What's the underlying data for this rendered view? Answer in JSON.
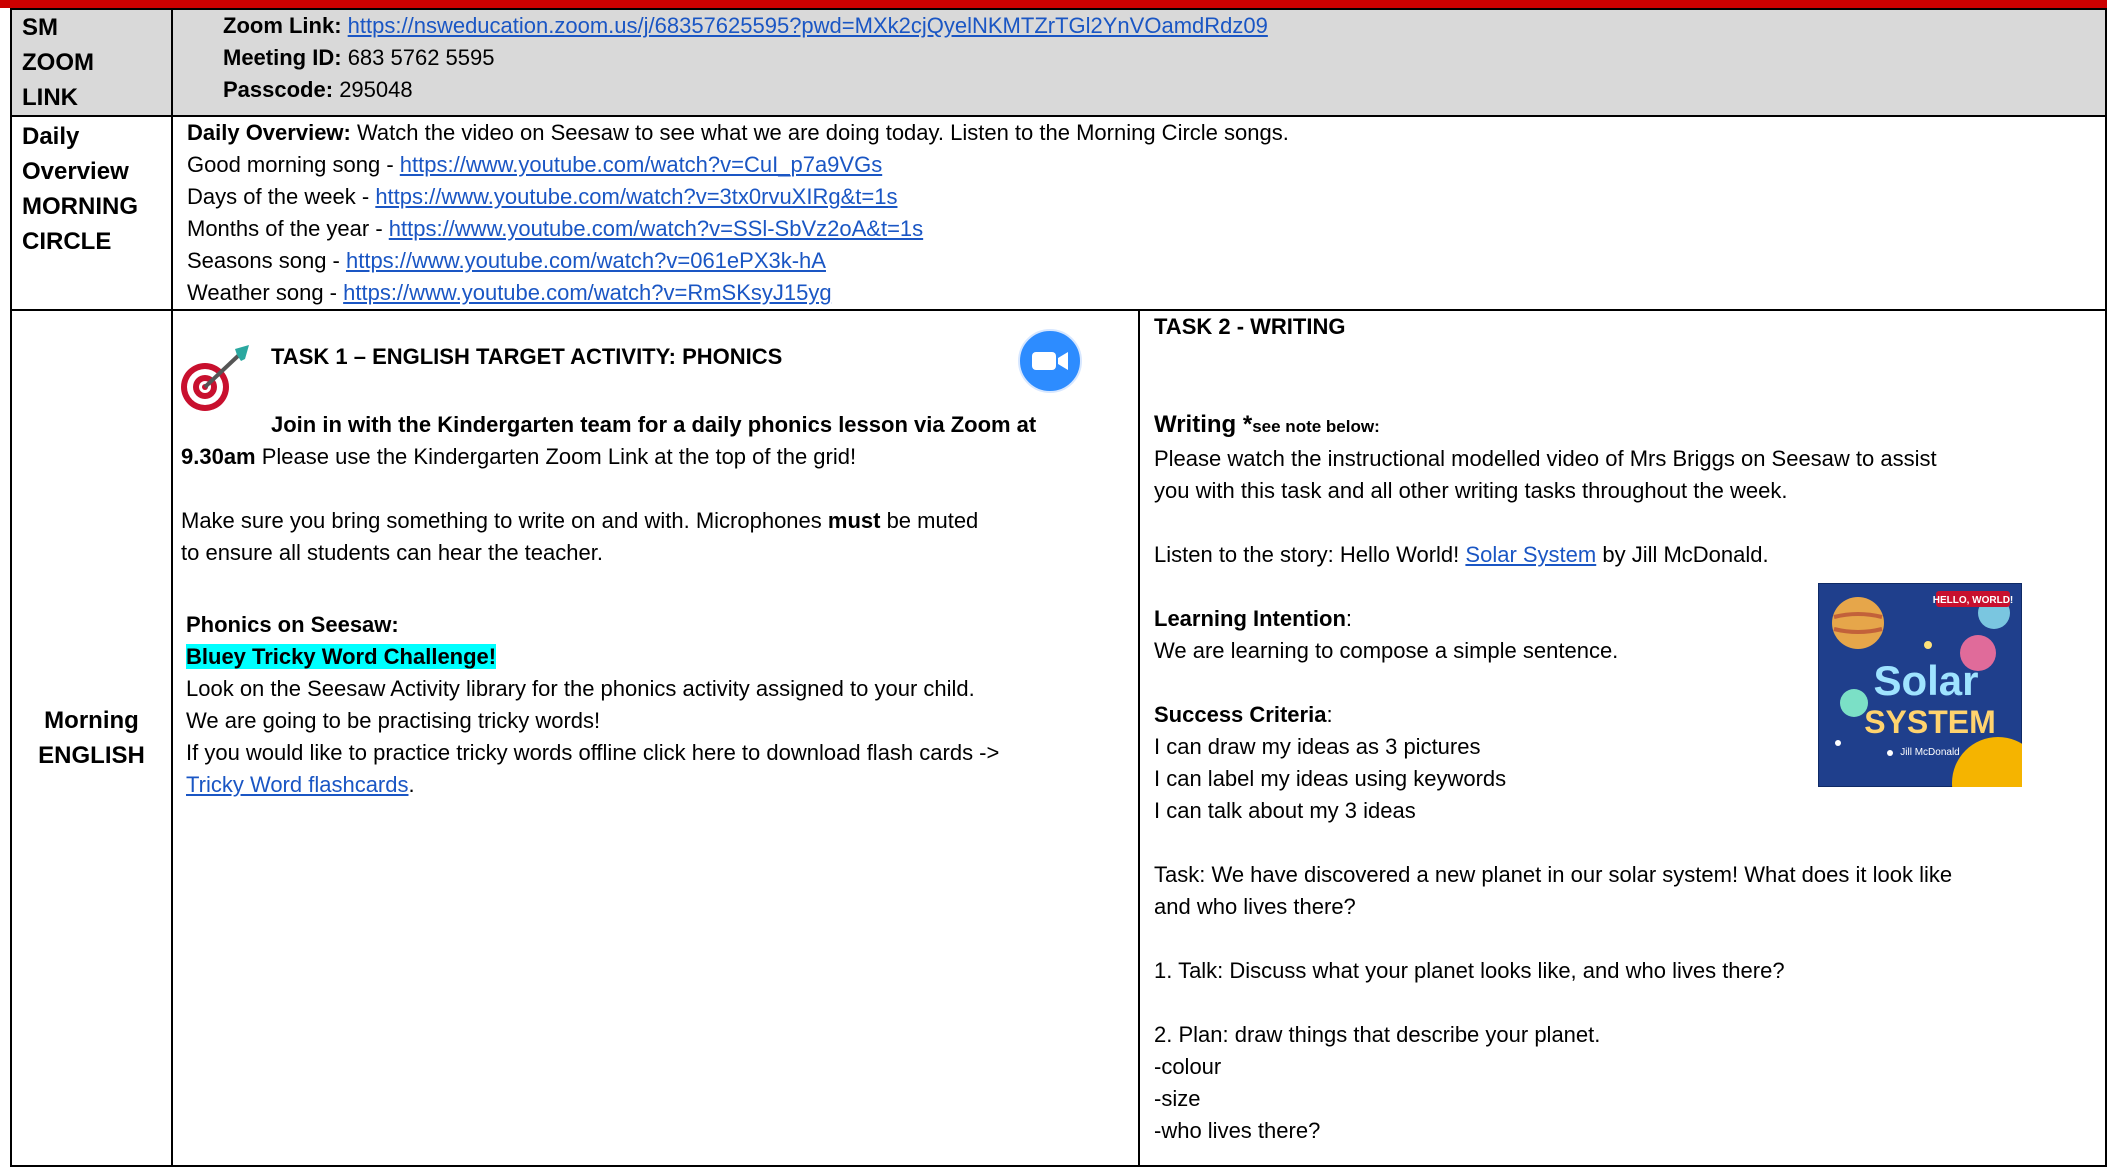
{
  "zoom_row": {
    "label": [
      "SM",
      "ZOOM",
      "LINK"
    ],
    "zoom_link_label": "Zoom Link:",
    "zoom_link_url": "https://nsweducation.zoom.us/j/68357625595?pwd=MXk2cjQyelNKMTZrTGl2YnVOamdRdz09",
    "meeting_id_label": "Meeting ID:",
    "meeting_id": "683 5762 5595",
    "passcode_label": "Passcode:",
    "passcode": "295048"
  },
  "overview_row": {
    "label": [
      "Daily",
      "Overview",
      "MORNING",
      "CIRCLE"
    ],
    "intro_label": "Daily Overview:",
    "intro_text": " Watch the video on Seesaw to see what we are doing today. Listen to the Morning Circle songs.",
    "songs": [
      {
        "name": "Good morning song - ",
        "url": "https://www.youtube.com/watch?v=CuI_p7a9VGs"
      },
      {
        "name": "Days of the week - ",
        "url": "https://www.youtube.com/watch?v=3tx0rvuXIRg&t=1s"
      },
      {
        "name": "Months of the year - ",
        "url": "https://www.youtube.com/watch?v=SSl-SbVz2oA&t=1s"
      },
      {
        "name": "Seasons song - ",
        "url": "https://www.youtube.com/watch?v=061ePX3k-hA"
      },
      {
        "name": "Weather song - ",
        "url": "https://www.youtube.com/watch?v=RmSKsyJ15yg"
      }
    ]
  },
  "english_row": {
    "label": [
      "Morning",
      "ENGLISH"
    ],
    "task1": {
      "heading": "TASK 1 – ENGLISH TARGET ACTIVITY: PHONICS",
      "join_bold": "Join in with the Kindergarten team for a daily phonics lesson via Zoom at",
      "time_bold": "9.30am",
      "join_rest": " Please use the Kindergarten Zoom Link at the top of the grid!",
      "bring_a": "Make sure you bring something to write on and with. Microphones ",
      "bring_must": "must",
      "bring_b": " be muted",
      "bring_c": "to ensure all students can hear the teacher.",
      "phonics_heading": "Phonics on Seesaw:",
      "challenge": "Bluey Tricky Word Challenge!",
      "look": "Look on the Seesaw Activity library for the phonics activity assigned to your child.",
      "practising": "We are going to be practising tricky words!",
      "offline": "If you would like to practice tricky words offline click here to download flash cards ->",
      "flashcards_link": "Tricky Word flashcards",
      "flashcards_after": "."
    },
    "task2": {
      "heading": "TASK 2 - WRITING",
      "writing_label": "Writing *",
      "writing_note": "see note below:",
      "watch_a": "Please watch the instructional modelled video of Mrs Briggs on Seesaw to assist",
      "watch_b": "you with this task and all other writing tasks throughout the week.",
      "story_a": "Listen to the story: Hello World! ",
      "story_link": "Solar System",
      "story_b": " by Jill McDonald.",
      "li_label": "Learning Intention",
      "li_colon": ":",
      "li_text": "We are learning to compose a simple sentence.",
      "sc_label": "Success Criteria",
      "sc_colon": ":",
      "sc_items": [
        "I can draw my ideas as 3 pictures",
        "I can label my ideas using keywords",
        "I can talk about my 3 ideas"
      ],
      "task_a": "Task: We have discovered a new planet in our solar system! What does it look like",
      "task_b": "and who lives there?",
      "step1": "1. Talk: Discuss what your planet looks like, and who lives there?",
      "step2": "2. Plan: draw things that describe your planet.",
      "plan_items": [
        "-colour",
        "-size",
        "-who lives there?"
      ],
      "book": {
        "top_text": "HELLO, WORLD!",
        "title_a": "Solar",
        "title_b": "SYSTEM",
        "author": "Jill McDonald"
      }
    }
  }
}
